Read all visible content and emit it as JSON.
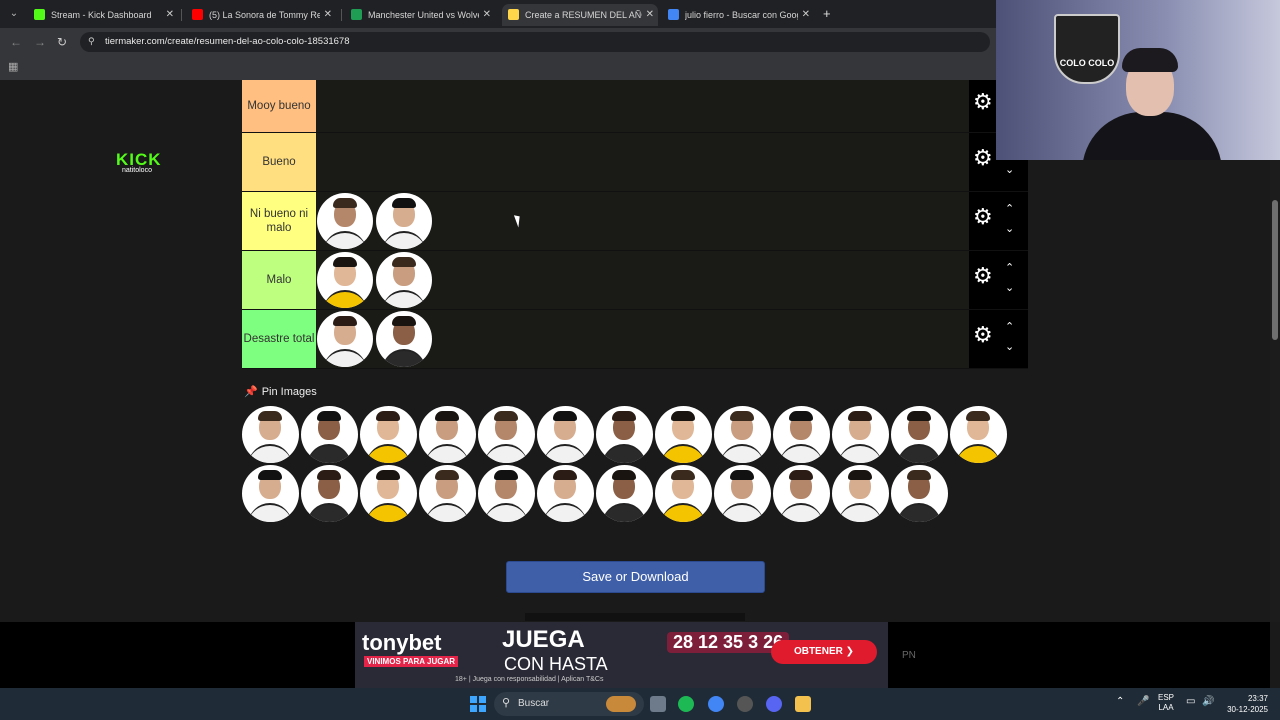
{
  "browser": {
    "tabs": [
      {
        "title": "Stream - Kick Dashboard",
        "color": "#53fc18"
      },
      {
        "title": "(5) La Sonora de Tommy Rey - D",
        "color": "#ff0000"
      },
      {
        "title": "Manchester United vs Wolverha",
        "color": "#1f9d55"
      },
      {
        "title": "Create a RESUMEN DEL AÑO C",
        "color": "#ffd54a"
      },
      {
        "title": "julio fierro - Buscar con Google",
        "color": "#4285f4"
      }
    ],
    "new_tab": "+",
    "url": "tiermaker.com/create/resumen-del-ao-colo-colo-18531678"
  },
  "tiers": [
    {
      "label": "Mooy bueno",
      "color": "#ffbf80",
      "items": 0
    },
    {
      "label": "Bueno",
      "color": "#ffdf80",
      "items": 0
    },
    {
      "label": "Ni bueno ni malo",
      "color": "#ffff80",
      "items": 2
    },
    {
      "label": "Malo",
      "color": "#bfff80",
      "items": 2
    },
    {
      "label": "Desastre total",
      "color": "#7fff7f",
      "items": 2
    }
  ],
  "pin_images_label": "Pin Images",
  "pool": {
    "row1": 13,
    "row2": 12
  },
  "save_button": "Save or Download",
  "ad": {
    "brand": "tonybet",
    "tagline": "VINIMOS PARA JUGAR",
    "headline": "JUEGA",
    "subheadline": "CON HASTA",
    "numbers": "28 12 35 3 26",
    "cta": "OBTENER",
    "legal": "18+ | Juega con responsabilidad | Aplican T&Cs",
    "side_text": "PN"
  },
  "taskbar": {
    "search_placeholder": "Buscar",
    "lang_top": "ESP",
    "lang_bottom": "LAA",
    "time": "23:37",
    "date": "30-12-2025"
  },
  "webcam": {
    "logo_text": "COLO COLO",
    "kick_text": "KICK",
    "kick_sub": "natitoloco"
  }
}
